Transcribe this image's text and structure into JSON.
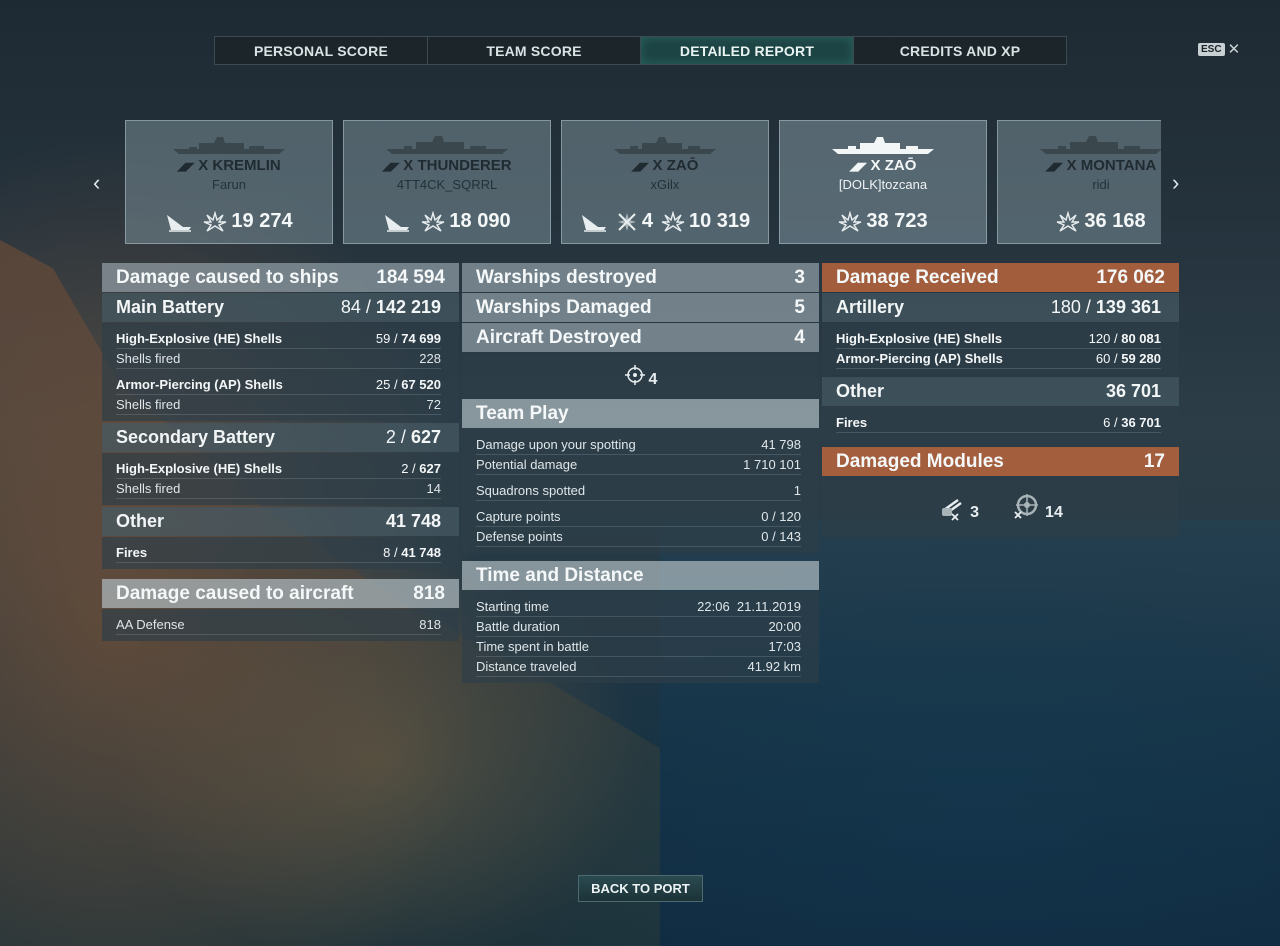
{
  "tabs": [
    {
      "label": "PERSONAL SCORE",
      "active": false
    },
    {
      "label": "TEAM SCORE",
      "active": false
    },
    {
      "label": "DETAILED REPORT",
      "active": true
    },
    {
      "label": "CREDITS AND XP",
      "active": false
    }
  ],
  "esc_label": "ESC",
  "close_glyph": "✕",
  "nav": {
    "prev": "‹",
    "next": "›"
  },
  "ships": [
    {
      "ship": "X KREMLIN",
      "player": "Farun",
      "damage": "19 274",
      "kills": "",
      "planes": ""
    },
    {
      "ship": "X THUNDERER",
      "player": "4TT4CK_SQRRL",
      "damage": "18 090",
      "kills": "",
      "planes": ""
    },
    {
      "ship": "X ZAŌ",
      "player": "xGilx",
      "damage": "10 319",
      "kills": "",
      "planes": "4"
    },
    {
      "ship": "X ZAŌ",
      "player": "[DOLK]tozcana",
      "damage": "38 723",
      "kills": "",
      "planes": ""
    },
    {
      "ship": "X MONTANA",
      "player": "ridi",
      "damage": "36 168",
      "kills": "",
      "planes": ""
    }
  ],
  "left": {
    "damage_ships": {
      "label": "Damage caused to ships",
      "value": "184 594"
    },
    "main_battery": {
      "label": "Main Battery",
      "hits": "84",
      "value": "142 219"
    },
    "main_rows": [
      {
        "label": "High-Explosive (HE) Shells",
        "hits": "59",
        "value": "74 699"
      },
      {
        "label": "Shells fired",
        "value": "228"
      },
      {
        "label": "Armor-Piercing (AP) Shells",
        "hits": "25",
        "value": "67 520"
      },
      {
        "label": "Shells fired",
        "value": "72"
      }
    ],
    "secondary": {
      "label": "Secondary Battery",
      "hits": "2",
      "value": "627"
    },
    "secondary_rows": [
      {
        "label": "High-Explosive (HE) Shells",
        "hits": "2",
        "value": "627"
      },
      {
        "label": "Shells fired",
        "value": "14"
      }
    ],
    "other": {
      "label": "Other",
      "value": "41 748"
    },
    "fires": {
      "label": "Fires",
      "hits": "8",
      "value": "41 748"
    },
    "damage_aircraft": {
      "label": "Damage caused to aircraft",
      "value": "818"
    },
    "aa": {
      "label": "AA Defense",
      "value": "818"
    }
  },
  "middle": {
    "warships_destroyed": {
      "label": "Warships destroyed",
      "value": "3"
    },
    "warships_damaged": {
      "label": "Warships Damaged",
      "value": "5"
    },
    "aircraft_destroyed": {
      "label": "Aircraft Destroyed",
      "value": "4"
    },
    "spotted_count": "4",
    "team_play": {
      "label": "Team Play"
    },
    "team_rows": [
      {
        "label": "Damage upon your spotting",
        "value": "41 798"
      },
      {
        "label": "Potential damage",
        "value": "1 710 101"
      },
      {
        "label": "Squadrons spotted",
        "value": "1"
      },
      {
        "label": "Capture points",
        "value": "0 / 120"
      },
      {
        "label": "Defense points",
        "value": "0 / 143"
      }
    ],
    "time": {
      "label": "Time and Distance"
    },
    "time_rows": [
      {
        "label": "Starting time",
        "value": "22:06  21.11.2019"
      },
      {
        "label": "Battle duration",
        "value": "20:00"
      },
      {
        "label": "Time spent in battle",
        "value": "17:03"
      },
      {
        "label": "Distance traveled",
        "value": "41.92 km"
      }
    ]
  },
  "right": {
    "damage_received": {
      "label": "Damage Received",
      "value": "176 062"
    },
    "artillery": {
      "label": "Artillery",
      "hits": "180",
      "value": "139 361"
    },
    "art_rows": [
      {
        "label": "High-Explosive (HE) Shells",
        "hits": "120",
        "value": "80 081"
      },
      {
        "label": "Armor-Piercing (AP) Shells",
        "hits": "60",
        "value": "59 280"
      }
    ],
    "other": {
      "label": "Other",
      "value": "36 701"
    },
    "fires": {
      "label": "Fires",
      "hits": "6",
      "value": "36 701"
    },
    "modules": {
      "label": "Damaged Modules",
      "value": "17"
    },
    "module_counts": {
      "guns": "3",
      "steering": "14"
    }
  },
  "back_button": "BACK TO PORT",
  "slash": "/",
  "colors": {
    "accent_tab": "#1d4444",
    "orange_header": "#b9643c"
  }
}
